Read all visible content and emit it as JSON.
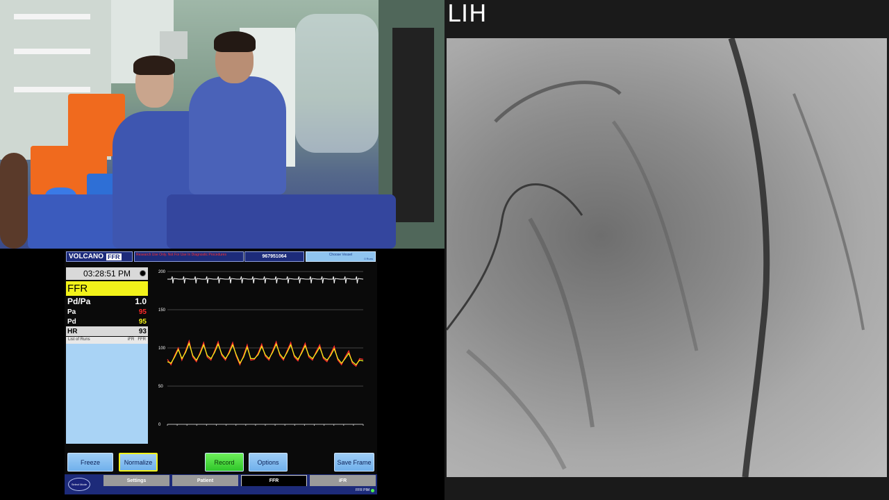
{
  "angio": {
    "label": "LIH"
  },
  "monitor": {
    "brand": "VOLCANO",
    "brand_badge": "FFR",
    "disclaimer": "Research Use Only. Not For Use In Diagnostic Procedures",
    "patient_id": "967951064",
    "choose_vessel": "Choose Vessel",
    "choose_vessel_sub": "0 Runs",
    "time": "03:28:51 PM",
    "mode": "FFR",
    "pdpa_label": "Pd/Pa",
    "pdpa_value": "1.0",
    "pa_label": "Pa",
    "pa_value": "95",
    "pd_label": "Pd",
    "pd_value": "95",
    "hr_label": "HR",
    "hr_value": "93",
    "runs_label": "List of Runs",
    "runs_col_ifr": "iFR",
    "runs_col_ffr": "FFR",
    "colors": {
      "pa": "#ff2a2a",
      "pd": "#f2f21a",
      "accent": "#1d2b7a",
      "button": "#8fc4ef",
      "record": "#3fd33a"
    }
  },
  "chart_data": {
    "type": "line",
    "yticks": [
      "200",
      "150",
      "100",
      "50",
      "0"
    ],
    "ylim": [
      0,
      200
    ],
    "series": [
      {
        "values": [
          85,
          78,
          90,
          100,
          84,
          96,
          109,
          88,
          82,
          94,
          107,
          88,
          84,
          96,
          108,
          90,
          84,
          95,
          107,
          89,
          78,
          90,
          104,
          84,
          85,
          93,
          105,
          89,
          84,
          96,
          108,
          90,
          84,
          96,
          107,
          88,
          83,
          95,
          106,
          88,
          84,
          95,
          104,
          86,
          82,
          92,
          102,
          84,
          78,
          88,
          96,
          80,
          76,
          86,
          85
        ]
      },
      {
        "values": [
          82,
          80,
          88,
          98,
          86,
          94,
          106,
          90,
          84,
          92,
          104,
          90,
          86,
          94,
          105,
          92,
          86,
          93,
          104,
          91,
          80,
          88,
          101,
          86,
          86,
          91,
          102,
          91,
          86,
          94,
          105,
          92,
          86,
          94,
          104,
          90,
          85,
          93,
          103,
          90,
          86,
          93,
          101,
          88,
          84,
          90,
          99,
          86,
          80,
          86,
          93,
          82,
          78,
          84,
          83
        ]
      }
    ]
  },
  "buttons": {
    "freeze": "Freeze",
    "normalize": "Normalize",
    "record": "Record",
    "options": "Options",
    "save_frame": "Save Frame"
  },
  "tabs": {
    "select_mode": "Select Mode",
    "settings": "Settings",
    "patient": "Patient",
    "ffr": "FFR",
    "ifr": "iFR",
    "status": "FFR PIM"
  }
}
